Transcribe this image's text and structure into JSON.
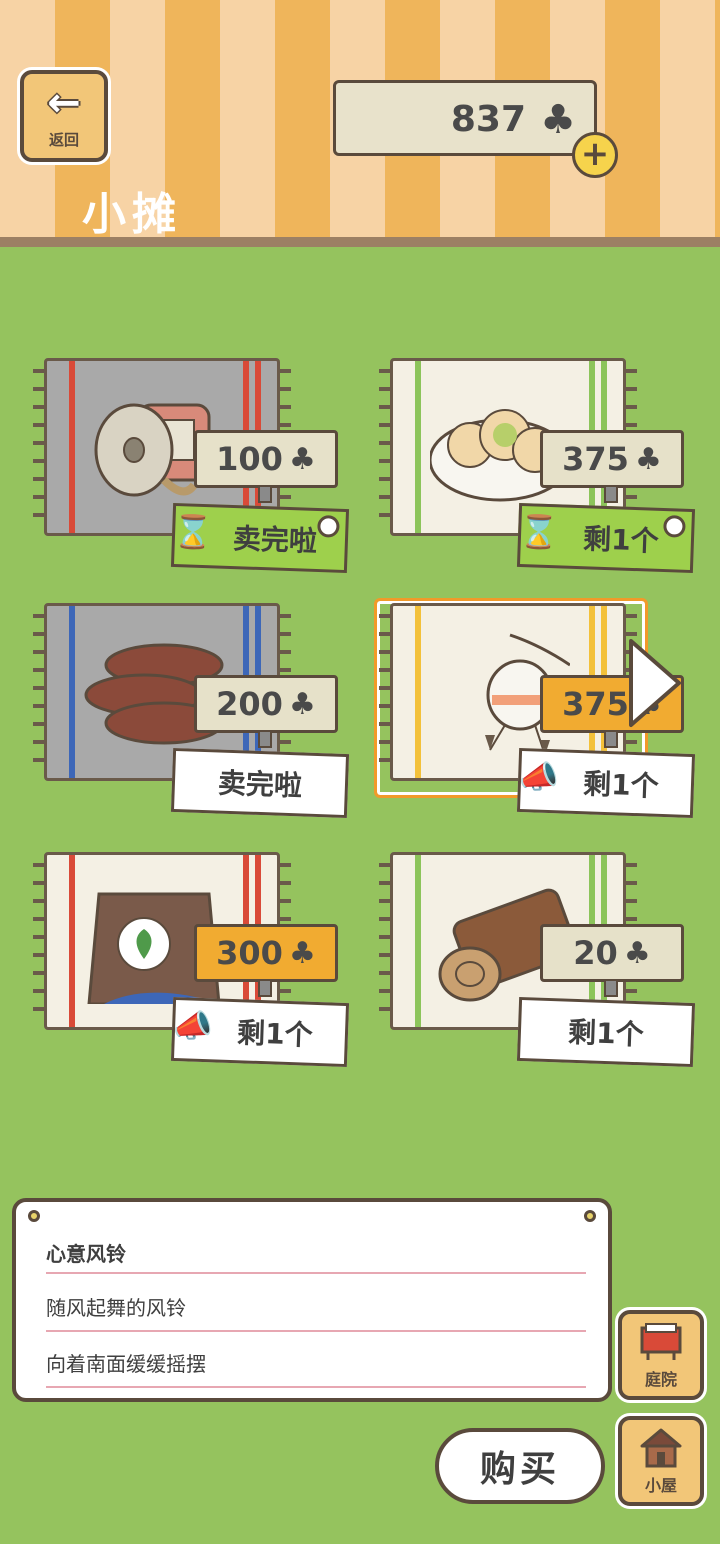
{
  "header": {
    "back_label": "返回",
    "title": "小摊",
    "clover_count": "837",
    "clover_icon": "♣",
    "add_icon": "+"
  },
  "items": [
    {
      "name": "item-yarn-spool",
      "price": "100",
      "status": "卖完啦",
      "sold_out": true,
      "rug_stripe": "#d94a38",
      "rug_color": "#a9a9a9"
    },
    {
      "name": "item-dumplings",
      "price": "375",
      "status": "剩1个",
      "sold_out": false,
      "rug_stripe": "#8cc45a",
      "rug_color": "#f4f0e4"
    },
    {
      "name": "item-wooden-plates",
      "price": "200",
      "status": "卖完啦",
      "sold_out": true,
      "rug_stripe": "#3d67b8",
      "rug_color": "#a9a9a9"
    },
    {
      "name": "item-wind-chime",
      "price": "375",
      "status": "剩1个",
      "sold_out": false,
      "rug_stripe": "#f3c13a",
      "rug_color": "#f4f0e4"
    },
    {
      "name": "item-fertilizer-bag",
      "price": "300",
      "status": "剩1个",
      "sold_out": false,
      "rug_stripe": "#d94a38",
      "rug_color": "#f4f0e4"
    },
    {
      "name": "item-log",
      "price": "20",
      "status": "剩1个",
      "sold_out": false,
      "rug_stripe": "#8cc45a",
      "rug_color": "#f4f0e4"
    }
  ],
  "description": {
    "title": "心意风铃",
    "line1": "随风起舞的风铃",
    "line2": "向着南面缓缓摇摆"
  },
  "buttons": {
    "yard": "庭院",
    "house": "小屋",
    "buy": "购买"
  },
  "colors": {
    "grass": "#95c35e",
    "price_hot": "#f1ab31",
    "sold_out_tag": "#9ed04c",
    "selection": "#f19a2a"
  }
}
